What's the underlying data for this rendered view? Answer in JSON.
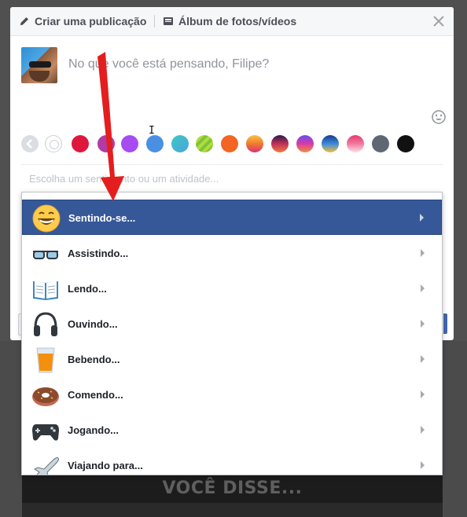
{
  "header": {
    "create_post_label": "Criar uma publicação",
    "album_label": "Álbum de fotos/vídeos",
    "close_icon": "close-icon"
  },
  "composer": {
    "placeholder": "No que você está pensando, Filipe?",
    "activity_placeholder": "Escolha um sentimento ou um atividade..."
  },
  "colors": {
    "swatches": [
      "#ffffff",
      "#e0173c",
      "#b33aa5",
      "#a64cf0",
      "#4a90e2",
      "#3ec8c0",
      "#7cc43a",
      "#f26522",
      "gradient-sunset",
      "gradient-dusk",
      "gradient-violet",
      "gradient-ocean",
      "gradient-pink",
      "#5f6772",
      "#111111"
    ]
  },
  "activities": [
    {
      "label": "Sentindo-se...",
      "icon": "grinning-face-icon"
    },
    {
      "label": "Assistindo...",
      "icon": "glasses-icon"
    },
    {
      "label": "Lendo...",
      "icon": "open-book-icon"
    },
    {
      "label": "Ouvindo...",
      "icon": "headphones-icon"
    },
    {
      "label": "Bebendo...",
      "icon": "glass-drink-icon"
    },
    {
      "label": "Comendo...",
      "icon": "donut-icon"
    },
    {
      "label": "Jogando...",
      "icon": "gamepad-icon"
    },
    {
      "label": "Viajando para...",
      "icon": "airplane-icon"
    }
  ],
  "banner": {
    "text": "VOCÊ DISSE..."
  },
  "theme": {
    "accent": "#365899",
    "arrow": "#e41e1e"
  }
}
